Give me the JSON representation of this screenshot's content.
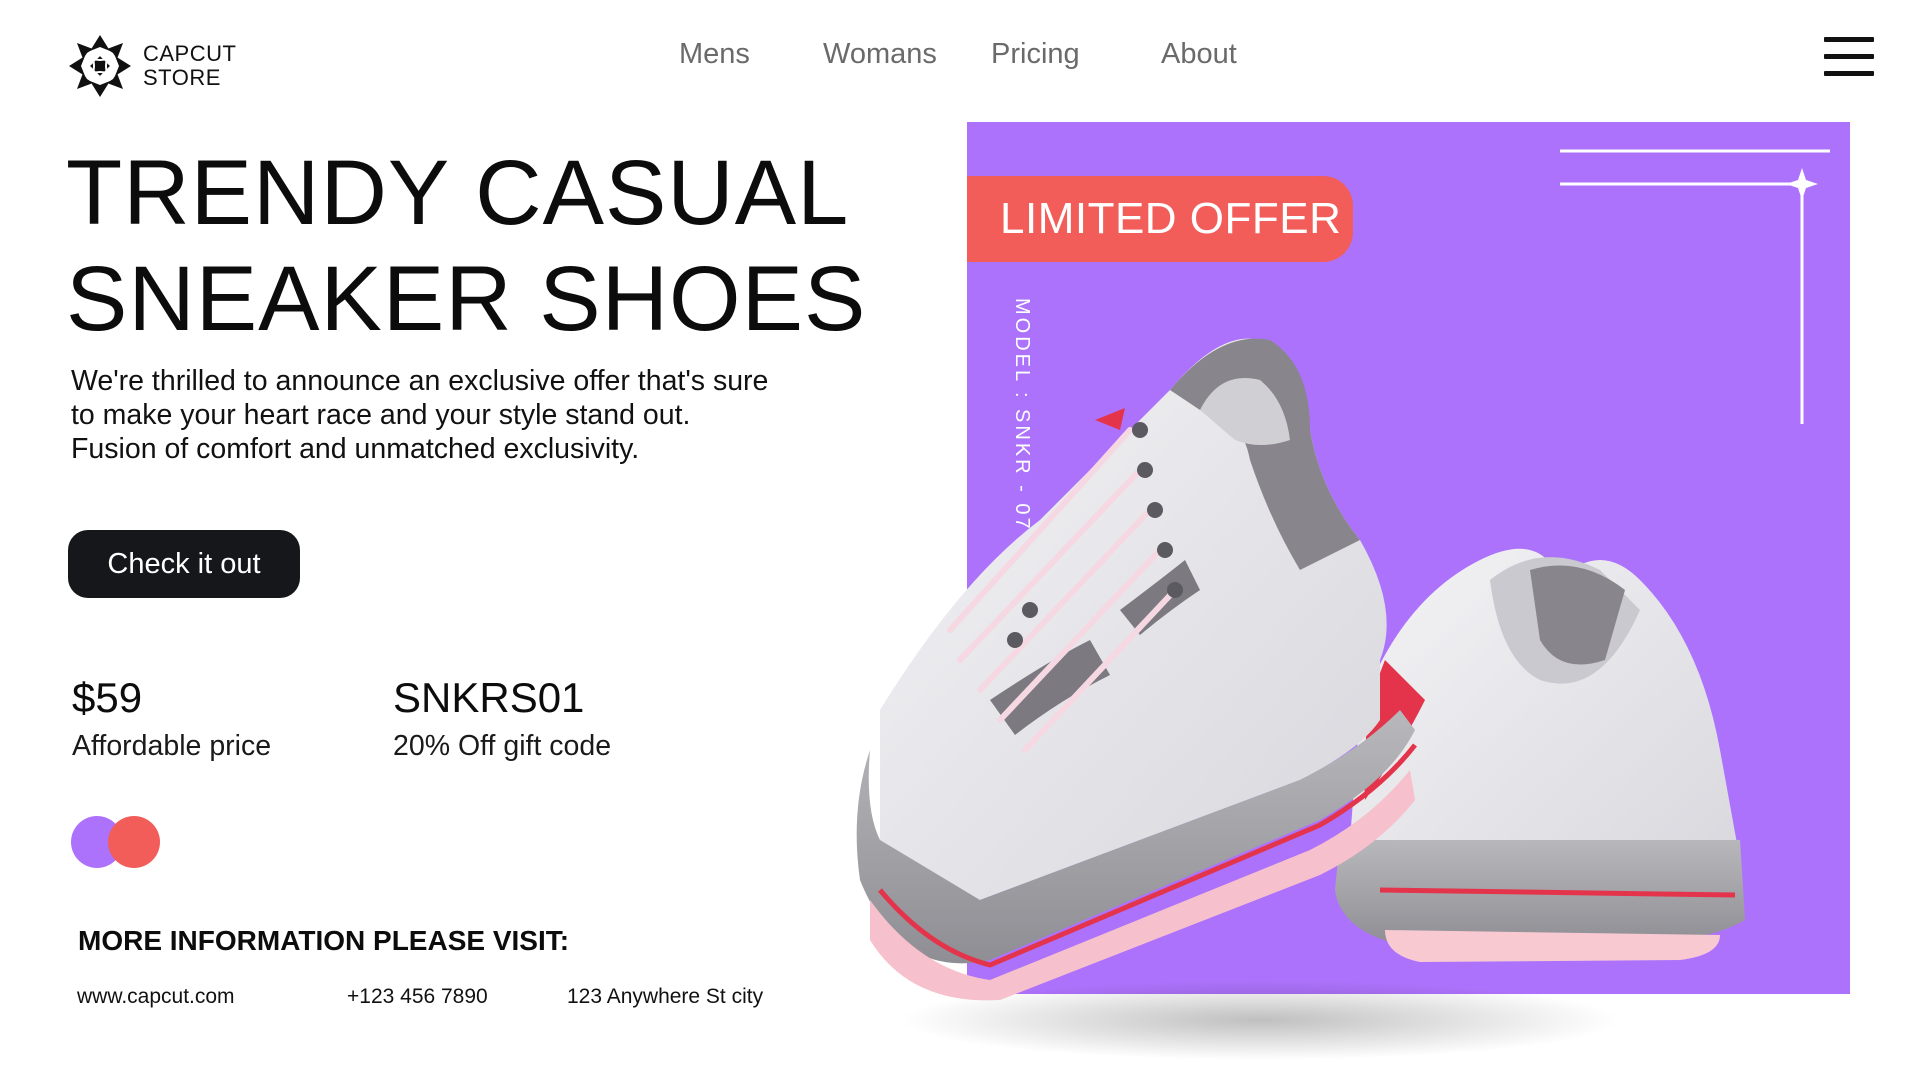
{
  "brand": {
    "line1": "CAPCUT",
    "line2": "STORE",
    "logo_icon": "star-knot-logo-icon"
  },
  "nav": {
    "items": [
      {
        "label": "Mens"
      },
      {
        "label": "Womans"
      },
      {
        "label": "Pricing"
      },
      {
        "label": "About"
      }
    ]
  },
  "menu_icon": "hamburger-menu-icon",
  "hero": {
    "title_line1": "TRENDY CASUAL",
    "title_line2": "SNEAKER SHOES",
    "description_lines": [
      "We're thrilled to announce an exclusive offer that's sure",
      "to make your heart race and your style stand out.",
      "Fusion of comfort and unmatched exclusivity."
    ],
    "cta_label": "Check it out"
  },
  "stats": [
    {
      "value": "$59",
      "label": "Affordable price"
    },
    {
      "value": "SNKRS01",
      "label": "20% Off gift code"
    }
  ],
  "color_options": [
    {
      "name": "purple",
      "color": "#ad72fb"
    },
    {
      "name": "coral",
      "color": "#f25d59"
    }
  ],
  "info": {
    "title": "MORE INFORMATION PLEASE VISIT:",
    "website": "www.capcut.com",
    "phone": "+123 456 7890",
    "address": "123 Anywhere St city"
  },
  "promo": {
    "badge": "LIMITED OFFER",
    "model": "MODEL : SNKR - 07",
    "colors": {
      "background": "#ad72fb",
      "badge": "#f25d59"
    }
  }
}
